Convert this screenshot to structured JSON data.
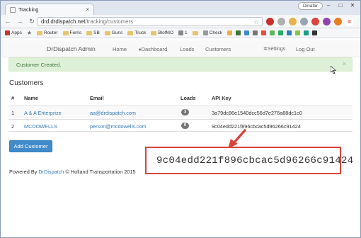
{
  "browser": {
    "tab_title": "Tracking",
    "tab_close": "×",
    "user_label": "Dinafar",
    "url_host": "drd.drdispatch.net",
    "url_path": "/tracking/customers",
    "back_glyph": "←",
    "forward_glyph": "→",
    "reload_glyph": "↻",
    "star_glyph": "☆",
    "minimize_glyph": "–",
    "maximize_glyph": "□",
    "close_glyph": "✕",
    "bookmarks": [
      {
        "label": "Apps"
      },
      {
        "label": ""
      },
      {
        "label": "Router"
      },
      {
        "label": "Ferris"
      },
      {
        "label": "SB"
      },
      {
        "label": "Guns"
      },
      {
        "label": "Truck"
      },
      {
        "label": "BlofMO"
      },
      {
        "label": "1"
      },
      {
        "label": ""
      },
      {
        "label": "Check"
      }
    ]
  },
  "app": {
    "brand": "DrDispatch Admin",
    "nav": {
      "home": "Home",
      "dashboard": "Dashboard",
      "loads": "Loads",
      "customers": "Customers",
      "settings": "Settings",
      "logout": "Log Out"
    },
    "alert": {
      "text": "Customer Created.",
      "close": "×"
    },
    "heading": "Customers",
    "table": {
      "headers": [
        "#",
        "Name",
        "Email",
        "Loads",
        "API Key"
      ],
      "rows": [
        {
          "num": "1",
          "name": "A & A Enterprize",
          "email": "aa@drdispatch.com",
          "loads": "3",
          "api_key": "3a79dc86e1540dcc56d7e276a88dc1c0"
        },
        {
          "num": "2",
          "name": "MCDOWELLS",
          "email": "person@mcdowells.com",
          "loads": "0",
          "api_key": "9c04edd221f896cbcac5d96266c91424"
        }
      ]
    },
    "add_button": "Add Customer",
    "footer": {
      "prefix": "Powered By ",
      "link": "DrDispatch",
      "suffix": " © Holland Transportation 2015"
    }
  },
  "callout": {
    "text": "9c04edd221f896cbcac5d96266c91424"
  },
  "colors": {
    "alert_bg": "#dff0d8",
    "alert_text": "#3c763d",
    "link": "#337ab7",
    "button": "#428bca",
    "callout_border": "#d9453a"
  }
}
